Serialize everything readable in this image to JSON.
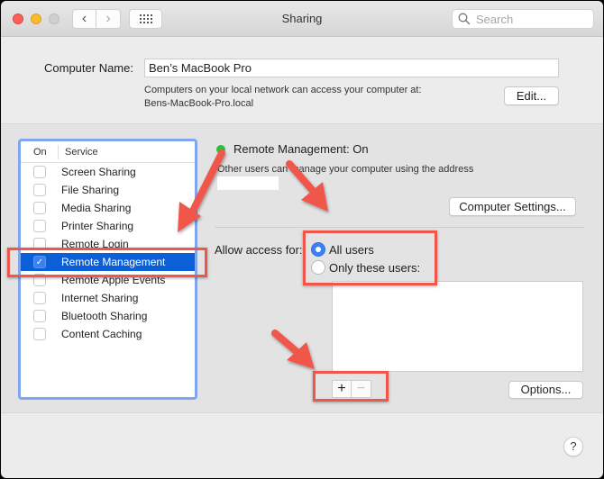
{
  "window": {
    "title": "Sharing",
    "search_placeholder": "Search",
    "nav": {
      "back": "‹",
      "forward": "›"
    }
  },
  "computer_name": {
    "label": "Computer Name:",
    "value": "Ben’s MacBook Pro",
    "description_line1": "Computers on your local network can access your computer at:",
    "description_line2": "Bens-MacBook-Pro.local",
    "edit_label": "Edit..."
  },
  "services": {
    "header_on": "On",
    "header_service": "Service",
    "items": [
      {
        "label": "Screen Sharing",
        "checked": false,
        "selected": false
      },
      {
        "label": "File Sharing",
        "checked": false,
        "selected": false
      },
      {
        "label": "Media Sharing",
        "checked": false,
        "selected": false
      },
      {
        "label": "Printer Sharing",
        "checked": false,
        "selected": false
      },
      {
        "label": "Remote Login",
        "checked": false,
        "selected": false
      },
      {
        "label": "Remote Management",
        "checked": true,
        "selected": true
      },
      {
        "label": "Remote Apple Events",
        "checked": false,
        "selected": false
      },
      {
        "label": "Internet Sharing",
        "checked": false,
        "selected": false
      },
      {
        "label": "Bluetooth Sharing",
        "checked": false,
        "selected": false
      },
      {
        "label": "Content Caching",
        "checked": false,
        "selected": false
      }
    ]
  },
  "detail": {
    "status_title": "Remote Management: On",
    "status_color": "#2cc13c",
    "status_desc": "Other users can manage your computer using the address",
    "computer_settings_label": "Computer Settings...",
    "allow_access_label": "Allow access for:",
    "radio_all": "All users",
    "radio_only": "Only these users:",
    "selected_access": "All users",
    "add_label": "+",
    "remove_label": "−",
    "options_label": "Options..."
  },
  "help_label": "?",
  "colors": {
    "selection": "#0b5fd7",
    "focus_ring": "#7fa6ee",
    "annotation": "#f0574a"
  }
}
